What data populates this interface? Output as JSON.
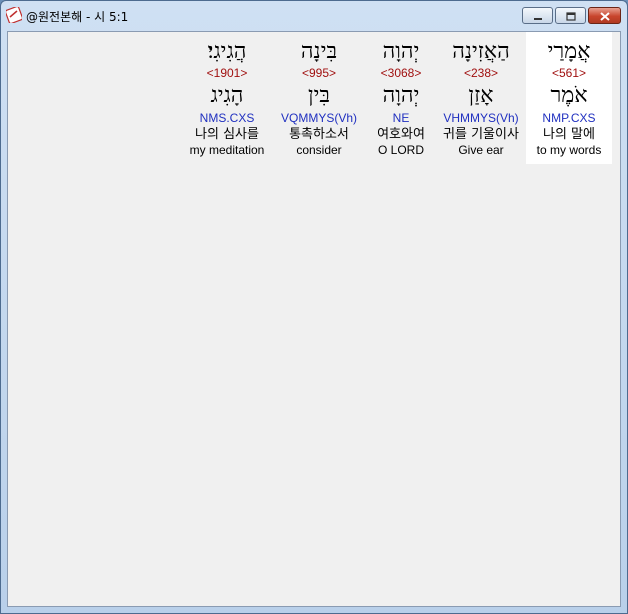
{
  "window": {
    "title": "@원전본해 - 시 5:1",
    "buttons": {
      "minimize": "minimize-icon",
      "maximize": "maximize-icon",
      "close": "close-icon"
    }
  },
  "colors": {
    "strong": "#a01010",
    "parse": "#2030c0",
    "selected_bg": "#ffffff"
  },
  "words": [
    {
      "hebrew": "אֲמָרַי",
      "strong": "<561>",
      "lemma": "אֹמֶר",
      "parse": "NMP.CXS",
      "korean": "나의 말에",
      "english": "to my words",
      "selected": true
    },
    {
      "hebrew": "הַאֲזִינָה",
      "strong": "<238>",
      "lemma": "אָזַן",
      "parse": "VHMMYS(Vh)",
      "korean": "귀를 기울이사",
      "english": "Give ear",
      "selected": false
    },
    {
      "hebrew": "יְהוָה",
      "strong": "<3068>",
      "lemma": "יְהוָה",
      "parse": "NE",
      "korean": "여호와여",
      "english": "O LORD",
      "selected": false
    },
    {
      "hebrew": "בִּינָה",
      "strong": "<995>",
      "lemma": "בִּין",
      "parse": "VQMMYS(Vh)",
      "korean": "통촉하소서",
      "english": "consider",
      "selected": false
    },
    {
      "hebrew": "הֲגִיגִי׃",
      "strong": "<1901>",
      "lemma": "הָגִיג",
      "parse": "NMS.CXS",
      "korean": "나의 심사를",
      "english": "my meditation",
      "selected": false
    }
  ]
}
